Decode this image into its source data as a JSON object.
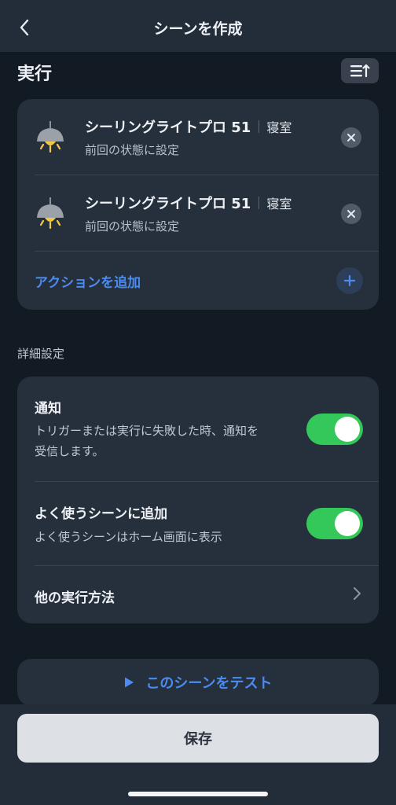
{
  "header": {
    "title": "シーンを作成",
    "back_icon": "chevron-left-icon"
  },
  "execution": {
    "section_title": "実行",
    "sort_icon": "sort-lines-icon",
    "actions": [
      {
        "device": "シーリングライトプロ 51",
        "room": "寝室",
        "state": "前回の状態に設定",
        "icon": "ceiling-lamp-icon"
      },
      {
        "device": "シーリングライトプロ 51",
        "room": "寝室",
        "state": "前回の状態に設定",
        "icon": "ceiling-lamp-icon"
      }
    ],
    "add_action_label": "アクションを追加"
  },
  "advanced": {
    "heading": "詳細設定",
    "notification": {
      "title": "通知",
      "description_line1": "トリガーまたは実行に失敗した時、通知を",
      "description_line2": "受信します。",
      "enabled": true
    },
    "favorite": {
      "title": "よく使うシーンに追加",
      "description": "よく使うシーンはホーム画面に表示",
      "enabled": true
    },
    "other_methods_label": "他の実行方法"
  },
  "test_button_label": "このシーンをテスト",
  "save_button_label": "保存",
  "colors": {
    "accent": "#4a8cf0",
    "toggle_on": "#34c759",
    "card": "#262f3c",
    "background": "#121a24"
  }
}
